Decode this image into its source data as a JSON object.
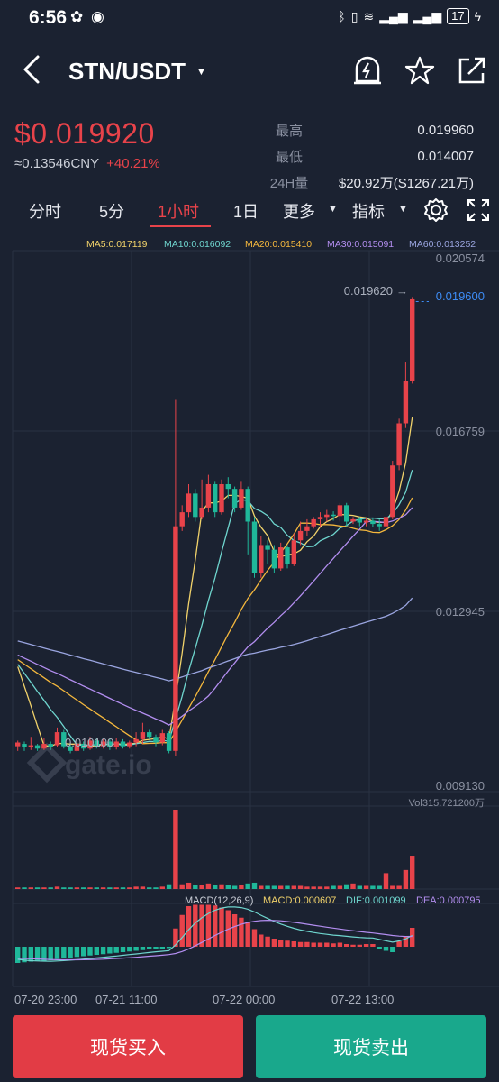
{
  "status": {
    "time": "6:56",
    "battery": "17"
  },
  "header": {
    "pair": "STN/USDT"
  },
  "ticker": {
    "last_price": "$0.019920",
    "cny_price": "≈0.13546CNY",
    "change": "+40.21%",
    "high_label": "最高",
    "high_value": "0.019960",
    "low_label": "最低",
    "low_value": "0.014007",
    "vol_label": "24H量",
    "vol_value": "$20.92万(S1267.21万)"
  },
  "tabs": [
    "分时",
    "5分",
    "1小时",
    "1日",
    "更多",
    "指标"
  ],
  "active_tab": "1小时",
  "colors": {
    "up": "#e8434a",
    "down": "#1fb89a",
    "ma5": "#f2d36b",
    "ma10": "#6fd6cf",
    "ma20": "#f5b83d",
    "ma30": "#b38ef0",
    "ma60": "#9aa5e0"
  },
  "chart_data": {
    "type": "candlestick",
    "ma_legend": {
      "ma5": "MA5:0.017119",
      "ma10": "MA10:0.016092",
      "ma20": "MA20:0.015410",
      "ma30": "MA30:0.015091",
      "ma60": "MA60:0.013252"
    },
    "y_ticks": [
      "0.020574",
      "0.016759",
      "0.012945",
      "0.009130"
    ],
    "y_range": [
      0.00913,
      0.020574
    ],
    "high_marker": "0.019620",
    "current_price_marker": "0.019600",
    "low_marker": "0.010100",
    "x_labels": [
      "07-20 23:00",
      "07-21 11:00",
      "07-22 00:00",
      "07-22 13:00"
    ],
    "candles": [
      [
        0.0101,
        0.01018,
        0.01022,
        0.01
      ],
      [
        0.01015,
        0.01008,
        0.0102,
        0.01
      ],
      [
        0.01008,
        0.01012,
        0.0103,
        0.01002
      ],
      [
        0.01012,
        0.01005,
        0.01015,
        0.01
      ],
      [
        0.01005,
        0.01015,
        0.01028,
        0.01002
      ],
      [
        0.01015,
        0.01008,
        0.0102,
        0.01002
      ],
      [
        0.01012,
        0.0104,
        0.0105,
        0.01008
      ],
      [
        0.0104,
        0.0101,
        0.01045,
        0.01005
      ],
      [
        0.0101,
        0.01,
        0.01015,
        0.00995
      ],
      [
        0.01,
        0.01015,
        0.01025,
        0.00998
      ],
      [
        0.01015,
        0.01005,
        0.0102,
        0.01
      ],
      [
        0.01005,
        0.01022,
        0.0103,
        0.01002
      ],
      [
        0.01022,
        0.0101,
        0.01028,
        0.01005
      ],
      [
        0.0101,
        0.0102,
        0.01025,
        0.01005
      ],
      [
        0.0102,
        0.01008,
        0.01025,
        0.01002
      ],
      [
        0.01008,
        0.0102,
        0.01028,
        0.01003
      ],
      [
        0.0102,
        0.0101,
        0.01025,
        0.01005
      ],
      [
        0.0101,
        0.01018,
        0.01022,
        0.01005
      ],
      [
        0.01018,
        0.01025,
        0.0104,
        0.0101
      ],
      [
        0.01025,
        0.0104,
        0.0106,
        0.01015
      ],
      [
        0.0104,
        0.0103,
        0.01045,
        0.01025
      ],
      [
        0.0103,
        0.01018,
        0.01035,
        0.0101
      ],
      [
        0.01018,
        0.01038,
        0.01045,
        0.01012
      ],
      [
        0.01038,
        0.01,
        0.01042,
        0.00995
      ],
      [
        0.01,
        0.0148,
        0.0175,
        0.0099
      ],
      [
        0.0148,
        0.0151,
        0.01525,
        0.0147
      ],
      [
        0.0151,
        0.0155,
        0.0157,
        0.015
      ],
      [
        0.0155,
        0.015,
        0.0156,
        0.0149
      ],
      [
        0.015,
        0.0152,
        0.0158,
        0.01495
      ],
      [
        0.0152,
        0.0157,
        0.0159,
        0.0151
      ],
      [
        0.0157,
        0.0151,
        0.01575,
        0.015
      ],
      [
        0.0151,
        0.0157,
        0.0158,
        0.01505
      ],
      [
        0.0157,
        0.0156,
        0.01585,
        0.0154
      ],
      [
        0.0156,
        0.0152,
        0.01565,
        0.0151
      ],
      [
        0.0152,
        0.0156,
        0.01575,
        0.01515
      ],
      [
        0.0156,
        0.0149,
        0.01565,
        0.0142
      ],
      [
        0.0149,
        0.0138,
        0.015,
        0.0137
      ],
      [
        0.0138,
        0.0144,
        0.0146,
        0.0137
      ],
      [
        0.0144,
        0.0143,
        0.0145,
        0.014
      ],
      [
        0.0143,
        0.0139,
        0.0144,
        0.0138
      ],
      [
        0.0139,
        0.01435,
        0.01445,
        0.01385
      ],
      [
        0.01435,
        0.014,
        0.0144,
        0.0139
      ],
      [
        0.014,
        0.0145,
        0.01465,
        0.01395
      ],
      [
        0.0145,
        0.0147,
        0.0149,
        0.0144
      ],
      [
        0.0147,
        0.0148,
        0.01495,
        0.0146
      ],
      [
        0.0148,
        0.01495,
        0.015,
        0.01475
      ],
      [
        0.01495,
        0.015,
        0.0151,
        0.0148
      ],
      [
        0.015,
        0.01505,
        0.01515,
        0.0149
      ],
      [
        0.01505,
        0.01502,
        0.01512,
        0.01492
      ],
      [
        0.01502,
        0.01525,
        0.0153,
        0.0149
      ],
      [
        0.01525,
        0.0149,
        0.0153,
        0.0148
      ],
      [
        0.0149,
        0.01495,
        0.015,
        0.01485
      ],
      [
        0.01495,
        0.01488,
        0.015,
        0.0148
      ],
      [
        0.01488,
        0.01492,
        0.01498,
        0.0148
      ],
      [
        0.01492,
        0.01485,
        0.01498,
        0.01478
      ],
      [
        0.01485,
        0.0148,
        0.01495,
        0.0147
      ],
      [
        0.0148,
        0.015,
        0.0151,
        0.01475
      ],
      [
        0.015,
        0.0161,
        0.0162,
        0.01495
      ],
      [
        0.0161,
        0.017,
        0.0171,
        0.016
      ],
      [
        0.017,
        0.0179,
        0.0183,
        0.0169
      ],
      [
        0.0179,
        0.01965,
        0.0197,
        0.01785
      ]
    ],
    "volume_label": "Vol315.721200万",
    "volume": [
      2,
      2,
      2,
      2,
      2,
      2,
      3,
      2,
      2,
      2,
      2,
      2,
      2,
      2,
      2,
      2,
      2,
      2,
      3,
      3,
      2,
      2,
      3,
      6,
      100,
      6,
      8,
      5,
      5,
      7,
      5,
      6,
      5,
      4,
      5,
      7,
      8,
      4,
      4,
      4,
      4,
      4,
      4,
      4,
      3,
      3,
      3,
      3,
      4,
      4,
      6,
      7,
      4,
      4,
      4,
      4,
      20,
      4,
      4,
      24,
      42
    ],
    "macd_legend": {
      "title": "MACD(12,26,9)",
      "macd": "MACD:0.000607",
      "dif": "DIF:0.001099",
      "dea": "DEA:0.000795"
    },
    "macd_hist": [
      -24,
      -23,
      -22,
      -21,
      -21,
      -20,
      -18,
      -17,
      -16,
      -15,
      -14,
      -13,
      -12,
      -11,
      -10,
      -9,
      -8,
      -7,
      -6,
      -5,
      -4,
      -3,
      -3,
      -2,
      27,
      47,
      60,
      62,
      62,
      62,
      61,
      58,
      54,
      48,
      43,
      36,
      26,
      18,
      15,
      12,
      10,
      9,
      8,
      7,
      7,
      6,
      6,
      6,
      5,
      6,
      4,
      3,
      3,
      4,
      4,
      -4,
      -6,
      -8,
      8,
      15,
      28
    ]
  },
  "footer": {
    "buy_label": "现货买入",
    "sell_label": "现货卖出"
  }
}
